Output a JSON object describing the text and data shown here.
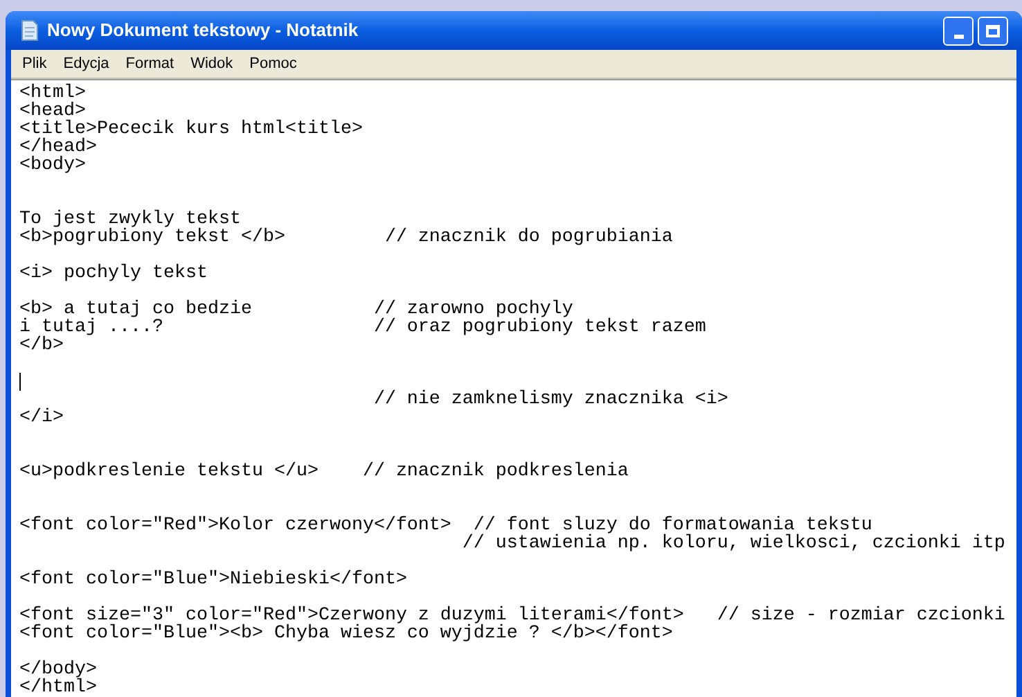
{
  "window": {
    "title": "Nowy Dokument tekstowy - Notatnik"
  },
  "menu": [
    "Plik",
    "Edycja",
    "Format",
    "Widok",
    "Pomoc"
  ],
  "document": {
    "text_before_cursor": "<html>\n<head>\n<title>Pececik kurs html<title>\n</head>\n<body>\n\n\nTo jest zwykly tekst\n<b>pogrubiony tekst </b>         // znacznik do pogrubiania\n\n<i> pochyly tekst\n\n<b> a tutaj co bedzie           // zarowno pochyly\ni tutaj ....?                   // oraz pogrubiony tekst razem\n</b>\n\n",
    "text_after_cursor": "\n                                // nie zamknelismy znacznika <i>\n</i>\n\n\n<u>podkreslenie tekstu </u>    // znacznik podkreslenia\n\n\n<font color=\"Red\">Kolor czerwony</font>  // font sluzy do formatowania tekstu\n                                        // ustawienia np. koloru, wielkosci, czcionki itp\n\n<font color=\"Blue\">Niebieski</font>\n\n<font size=\"3\" color=\"Red\">Czerwony z duzymi literami</font>   // size - rozmiar czcionki\n<font color=\"Blue\"><b> Chyba wiesz co wyjdzie ? </b></font>\n\n</body>\n</html>"
  }
}
